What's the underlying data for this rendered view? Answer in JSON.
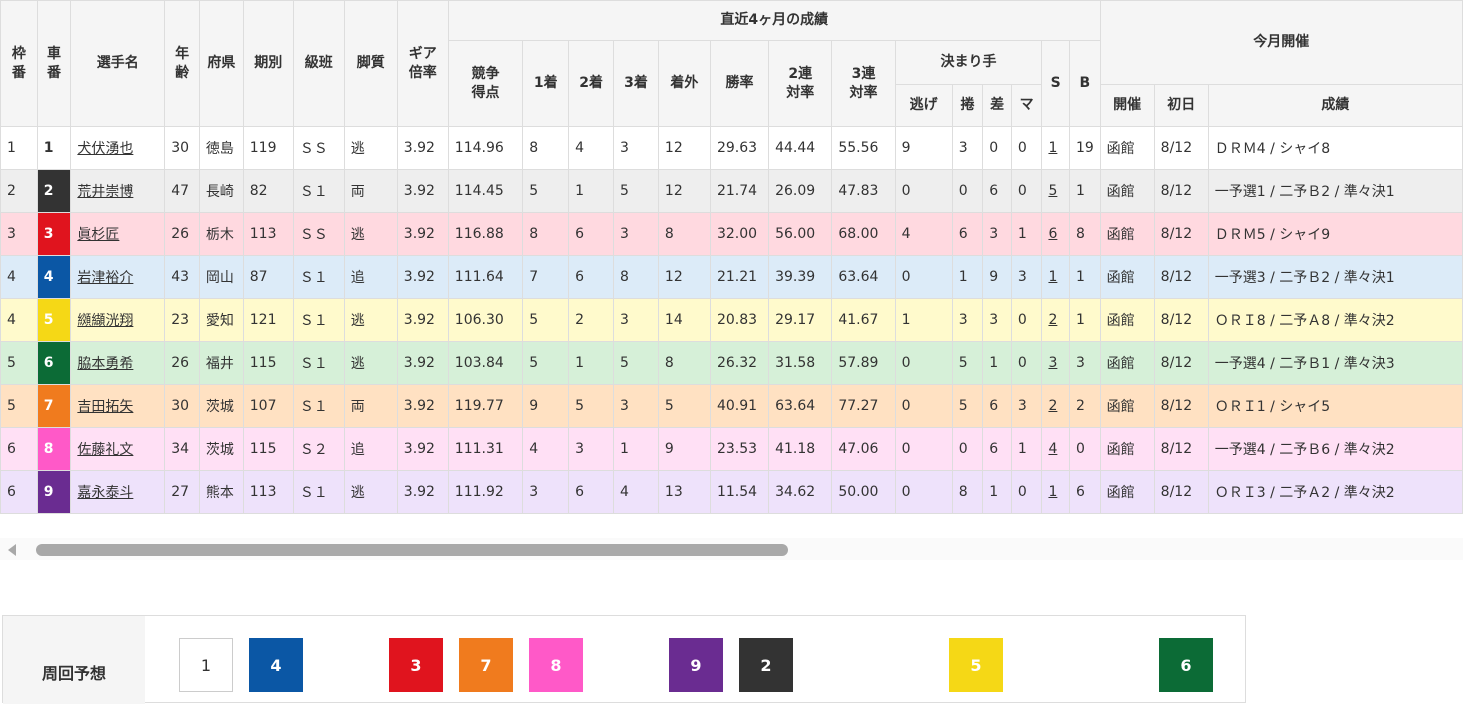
{
  "headers": {
    "waku": "枠番",
    "sha": "車番",
    "name": "選手名",
    "age": "年齢",
    "pref": "府県",
    "term": "期別",
    "class": "級班",
    "leg": "脚質",
    "gear": "ギア倍率",
    "recent": "直近4ヶ月の成績",
    "score": "競争得点",
    "first": "1着",
    "second": "2着",
    "third": "3着",
    "out": "着外",
    "win_rate": "勝率",
    "rate2": "2連対率",
    "rate3": "3連対率",
    "kimarite": "決まり手",
    "nige": "逃げ",
    "makuri": "捲",
    "sashi": "差",
    "mark": "マ",
    "s": "S",
    "b": "B",
    "this_month": "今月開催",
    "venue": "開催",
    "first_day": "初日",
    "results": "成績"
  },
  "riders": [
    {
      "waku": "1",
      "sha": "1",
      "name": "犬伏湧也",
      "age": "30",
      "pref": "徳島",
      "term": "119",
      "class": "ＳＳ",
      "leg": "逃",
      "gear": "3.92",
      "score": "114.96",
      "w1": "8",
      "w2": "4",
      "w3": "3",
      "out": "12",
      "win": "29.63",
      "r2": "44.44",
      "r3": "55.56",
      "nige": "9",
      "makuri": "3",
      "sashi": "0",
      "mark": "0",
      "s": "1",
      "b": "19",
      "venue": "函館",
      "day": "8/12",
      "result": "ＤＲＭ4 / シャイ8"
    },
    {
      "waku": "2",
      "sha": "2",
      "name": "荒井崇博",
      "age": "47",
      "pref": "長崎",
      "term": "82",
      "class": "Ｓ１",
      "leg": "両",
      "gear": "3.92",
      "score": "114.45",
      "w1": "5",
      "w2": "1",
      "w3": "5",
      "out": "12",
      "win": "21.74",
      "r2": "26.09",
      "r3": "47.83",
      "nige": "0",
      "makuri": "0",
      "sashi": "6",
      "mark": "0",
      "s": "5",
      "b": "1",
      "venue": "函館",
      "day": "8/12",
      "result": "一予選1 / 二予Ｂ2 / 準々決1"
    },
    {
      "waku": "3",
      "sha": "3",
      "name": "眞杉匠",
      "age": "26",
      "pref": "栃木",
      "term": "113",
      "class": "ＳＳ",
      "leg": "逃",
      "gear": "3.92",
      "score": "116.88",
      "w1": "8",
      "w2": "6",
      "w3": "3",
      "out": "8",
      "win": "32.00",
      "r2": "56.00",
      "r3": "68.00",
      "nige": "4",
      "makuri": "6",
      "sashi": "3",
      "mark": "1",
      "s": "6",
      "b": "8",
      "venue": "函館",
      "day": "8/12",
      "result": "ＤＲＭ5 / シャイ9"
    },
    {
      "waku": "4",
      "sha": "4",
      "name": "岩津裕介",
      "age": "43",
      "pref": "岡山",
      "term": "87",
      "class": "Ｓ１",
      "leg": "追",
      "gear": "3.92",
      "score": "111.64",
      "w1": "7",
      "w2": "6",
      "w3": "8",
      "out": "12",
      "win": "21.21",
      "r2": "39.39",
      "r3": "63.64",
      "nige": "0",
      "makuri": "1",
      "sashi": "9",
      "mark": "3",
      "s": "1",
      "b": "1",
      "venue": "函館",
      "day": "8/12",
      "result": "一予選3 / 二予Ｂ2 / 準々決1"
    },
    {
      "waku": "4",
      "sha": "5",
      "name": "纐纈洸翔",
      "age": "23",
      "pref": "愛知",
      "term": "121",
      "class": "Ｓ１",
      "leg": "逃",
      "gear": "3.92",
      "score": "106.30",
      "w1": "5",
      "w2": "2",
      "w3": "3",
      "out": "14",
      "win": "20.83",
      "r2": "29.17",
      "r3": "41.67",
      "nige": "1",
      "makuri": "3",
      "sashi": "3",
      "mark": "0",
      "s": "2",
      "b": "1",
      "venue": "函館",
      "day": "8/12",
      "result": "ＯＲＩ8 / 二予Ａ8 / 準々決2"
    },
    {
      "waku": "5",
      "sha": "6",
      "name": "脇本勇希",
      "age": "26",
      "pref": "福井",
      "term": "115",
      "class": "Ｓ１",
      "leg": "逃",
      "gear": "3.92",
      "score": "103.84",
      "w1": "5",
      "w2": "1",
      "w3": "5",
      "out": "8",
      "win": "26.32",
      "r2": "31.58",
      "r3": "57.89",
      "nige": "0",
      "makuri": "5",
      "sashi": "1",
      "mark": "0",
      "s": "3",
      "b": "3",
      "venue": "函館",
      "day": "8/12",
      "result": "一予選4 / 二予Ｂ1 / 準々決3"
    },
    {
      "waku": "5",
      "sha": "7",
      "name": "吉田拓矢",
      "age": "30",
      "pref": "茨城",
      "term": "107",
      "class": "Ｓ１",
      "leg": "両",
      "gear": "3.92",
      "score": "119.77",
      "w1": "9",
      "w2": "5",
      "w3": "3",
      "out": "5",
      "win": "40.91",
      "r2": "63.64",
      "r3": "77.27",
      "nige": "0",
      "makuri": "5",
      "sashi": "6",
      "mark": "3",
      "s": "2",
      "b": "2",
      "venue": "函館",
      "day": "8/12",
      "result": "ＯＲＩ1 / シャイ5"
    },
    {
      "waku": "6",
      "sha": "8",
      "name": "佐藤礼文",
      "age": "34",
      "pref": "茨城",
      "term": "115",
      "class": "Ｓ２",
      "leg": "追",
      "gear": "3.92",
      "score": "111.31",
      "w1": "4",
      "w2": "3",
      "w3": "1",
      "out": "9",
      "win": "23.53",
      "r2": "41.18",
      "r3": "47.06",
      "nige": "0",
      "makuri": "0",
      "sashi": "6",
      "mark": "1",
      "s": "4",
      "b": "0",
      "venue": "函館",
      "day": "8/12",
      "result": "一予選4 / 二予Ｂ6 / 準々決2"
    },
    {
      "waku": "6",
      "sha": "9",
      "name": "嘉永泰斗",
      "age": "27",
      "pref": "熊本",
      "term": "113",
      "class": "Ｓ１",
      "leg": "逃",
      "gear": "3.92",
      "score": "111.92",
      "w1": "3",
      "w2": "6",
      "w3": "4",
      "out": "13",
      "win": "11.54",
      "r2": "34.62",
      "r3": "50.00",
      "nige": "0",
      "makuri": "8",
      "sashi": "1",
      "mark": "0",
      "s": "1",
      "b": "6",
      "venue": "函館",
      "day": "8/12",
      "result": "ＯＲＩ3 / 二予Ａ2 / 準々決2"
    }
  ],
  "car_colors": {
    "1": {
      "bg": "#ffffff",
      "fg": "#333333"
    },
    "2": {
      "bg": "#333333",
      "fg": "#ffffff"
    },
    "3": {
      "bg": "#e0141e",
      "fg": "#ffffff"
    },
    "4": {
      "bg": "#0b57a5",
      "fg": "#ffffff"
    },
    "5": {
      "bg": "#f5d816",
      "fg": "#ffffff"
    },
    "6": {
      "bg": "#0c6b36",
      "fg": "#ffffff"
    },
    "7": {
      "bg": "#f07b1e",
      "fg": "#ffffff"
    },
    "8": {
      "bg": "#ff59c8",
      "fg": "#ffffff"
    },
    "9": {
      "bg": "#6a2c91",
      "fg": "#ffffff"
    }
  },
  "row_colors": {
    "1": "#ffffff",
    "2": "#eeeeee",
    "3": "#ffd9e0",
    "4": "#dcebf8",
    "5": "#fffacc",
    "6": "#d6f0d8",
    "7": "#ffe1c2",
    "8": "#ffe0f5",
    "9": "#eee2fb"
  },
  "prediction": {
    "label": "周回予想",
    "cars": [
      "1",
      "4",
      "3",
      "7",
      "8",
      "9",
      "2",
      "5",
      "6"
    ]
  }
}
